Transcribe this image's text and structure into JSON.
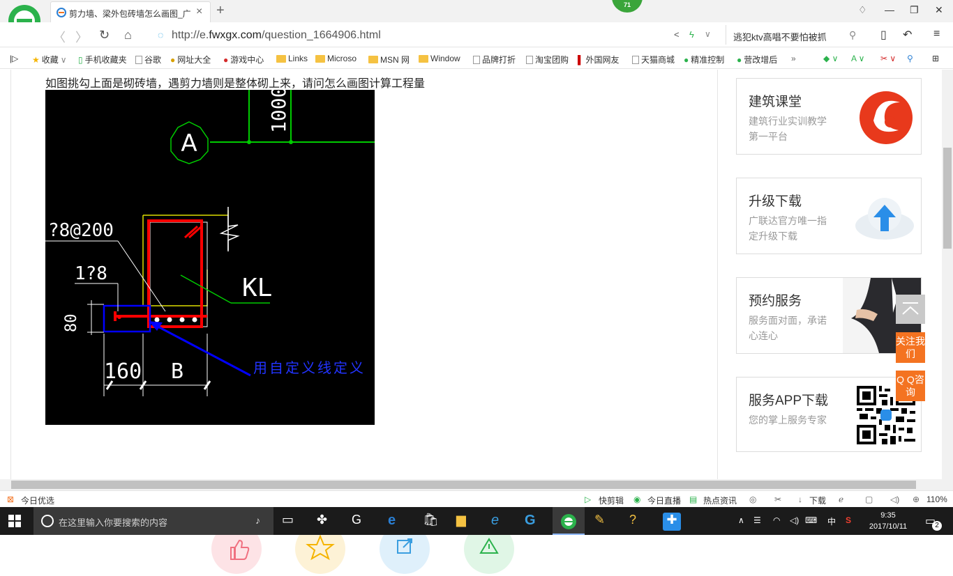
{
  "browser": {
    "tab_title": "剪力墙、梁外包砖墙怎么画图_广",
    "badge": "71",
    "url_prefix": "http://e.",
    "url_domain": "fwxgx.com",
    "url_path": "/question_1664906.html",
    "search_text": "逃犯ktv高唱不要怕被抓"
  },
  "bookmarks": [
    {
      "label": "收藏",
      "icon": "star-icon"
    },
    {
      "label": "手机收藏夹",
      "icon": "phone-icon"
    },
    {
      "label": "谷歌",
      "icon": "page-icon"
    },
    {
      "label": "网址大全",
      "icon": "globe-icon"
    },
    {
      "label": "游戏中心",
      "icon": "game-icon"
    },
    {
      "label": "Links",
      "icon": "folder-icon"
    },
    {
      "label": "Microso",
      "icon": "folder-icon"
    },
    {
      "label": "MSN 网",
      "icon": "folder-icon"
    },
    {
      "label": "Window",
      "icon": "folder-icon"
    },
    {
      "label": "品牌打折",
      "icon": "page-icon"
    },
    {
      "label": "淘宝团购",
      "icon": "page-icon"
    },
    {
      "label": "外国网友",
      "icon": "flag-icon"
    },
    {
      "label": "天猫商城",
      "icon": "page-icon"
    },
    {
      "label": "精准控制",
      "icon": "wechat-icon"
    },
    {
      "label": "营改增后",
      "icon": "wechat-icon"
    }
  ],
  "content": {
    "question": "如图挑勾上面是砌砖墙，遇剪力墙则是整体砌上来，请问怎么画图计算工程量"
  },
  "cad": {
    "axis_label": "A",
    "dim_1000": "1000",
    "rebar_label_1": "?8@200",
    "rebar_label_2": "1?8",
    "dim_80": "80",
    "beam_label": "KL",
    "dim_160": "160",
    "dim_b": "B",
    "annotation": "用自定义线定义"
  },
  "sidebar": {
    "cards": [
      {
        "title": "建筑课堂",
        "desc": "建筑行业实训教学第一平台"
      },
      {
        "title": "升级下载",
        "desc": "广联达官方唯一指定升级下载"
      },
      {
        "title": "预约服务",
        "desc": "服务面对面，承诺心连心"
      },
      {
        "title": "服务APP下载",
        "desc": "您的掌上服务专家"
      }
    ],
    "follow_label": "关注我们",
    "qq_label": "Q Q咨询"
  },
  "statusbar": {
    "left": "今日优选",
    "kuaijianji": "快剪辑",
    "zhibo": "今日直播",
    "redian": "热点资讯",
    "download": "下载",
    "zoom": "110%"
  },
  "taskbar": {
    "search_placeholder": "在这里输入你要搜索的内容",
    "ime": "中",
    "time": "9:35",
    "date": "2017/10/11",
    "notif_count": "2"
  }
}
